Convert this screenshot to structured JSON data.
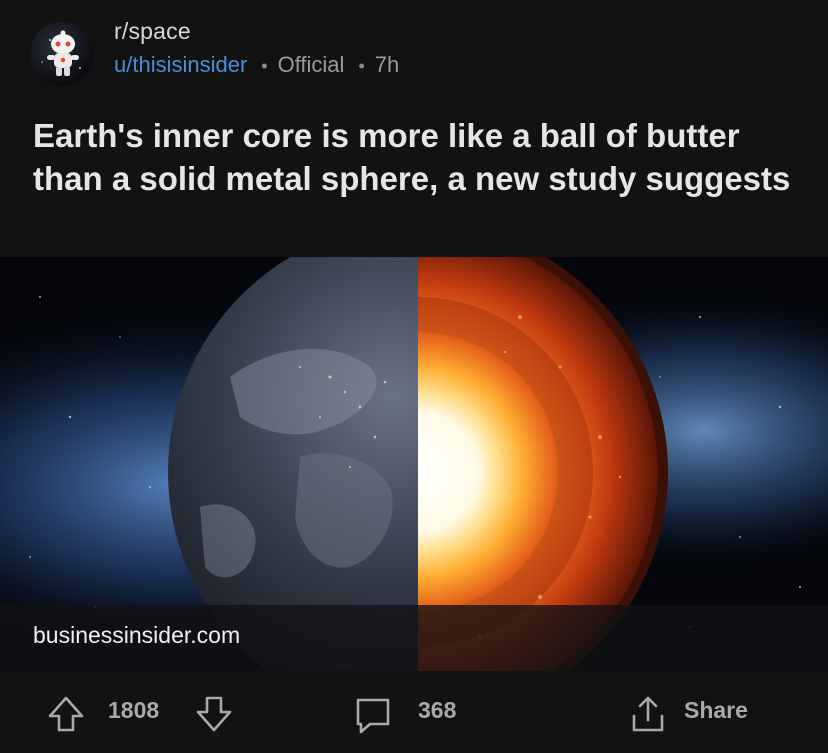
{
  "post": {
    "subreddit": "r/space",
    "author": "u/thisisinsider",
    "separator": "•",
    "flair": "Official",
    "age": "7h",
    "title": "Earth's inner core is more like a ball of butter than a solid metal sphere, a new study suggests",
    "link_domain": "businessinsider.com"
  },
  "actions": {
    "score": "1808",
    "comments": "368",
    "share_label": "Share"
  },
  "icons": {
    "upvote": "upvote-arrow-icon",
    "downvote": "downvote-arrow-icon",
    "comment": "comment-bubble-icon",
    "share": "share-icon"
  },
  "colors": {
    "background": "#121213",
    "username": "#4a8fd6",
    "muted": "#9a9aa0",
    "title": "#e6e6e6"
  }
}
